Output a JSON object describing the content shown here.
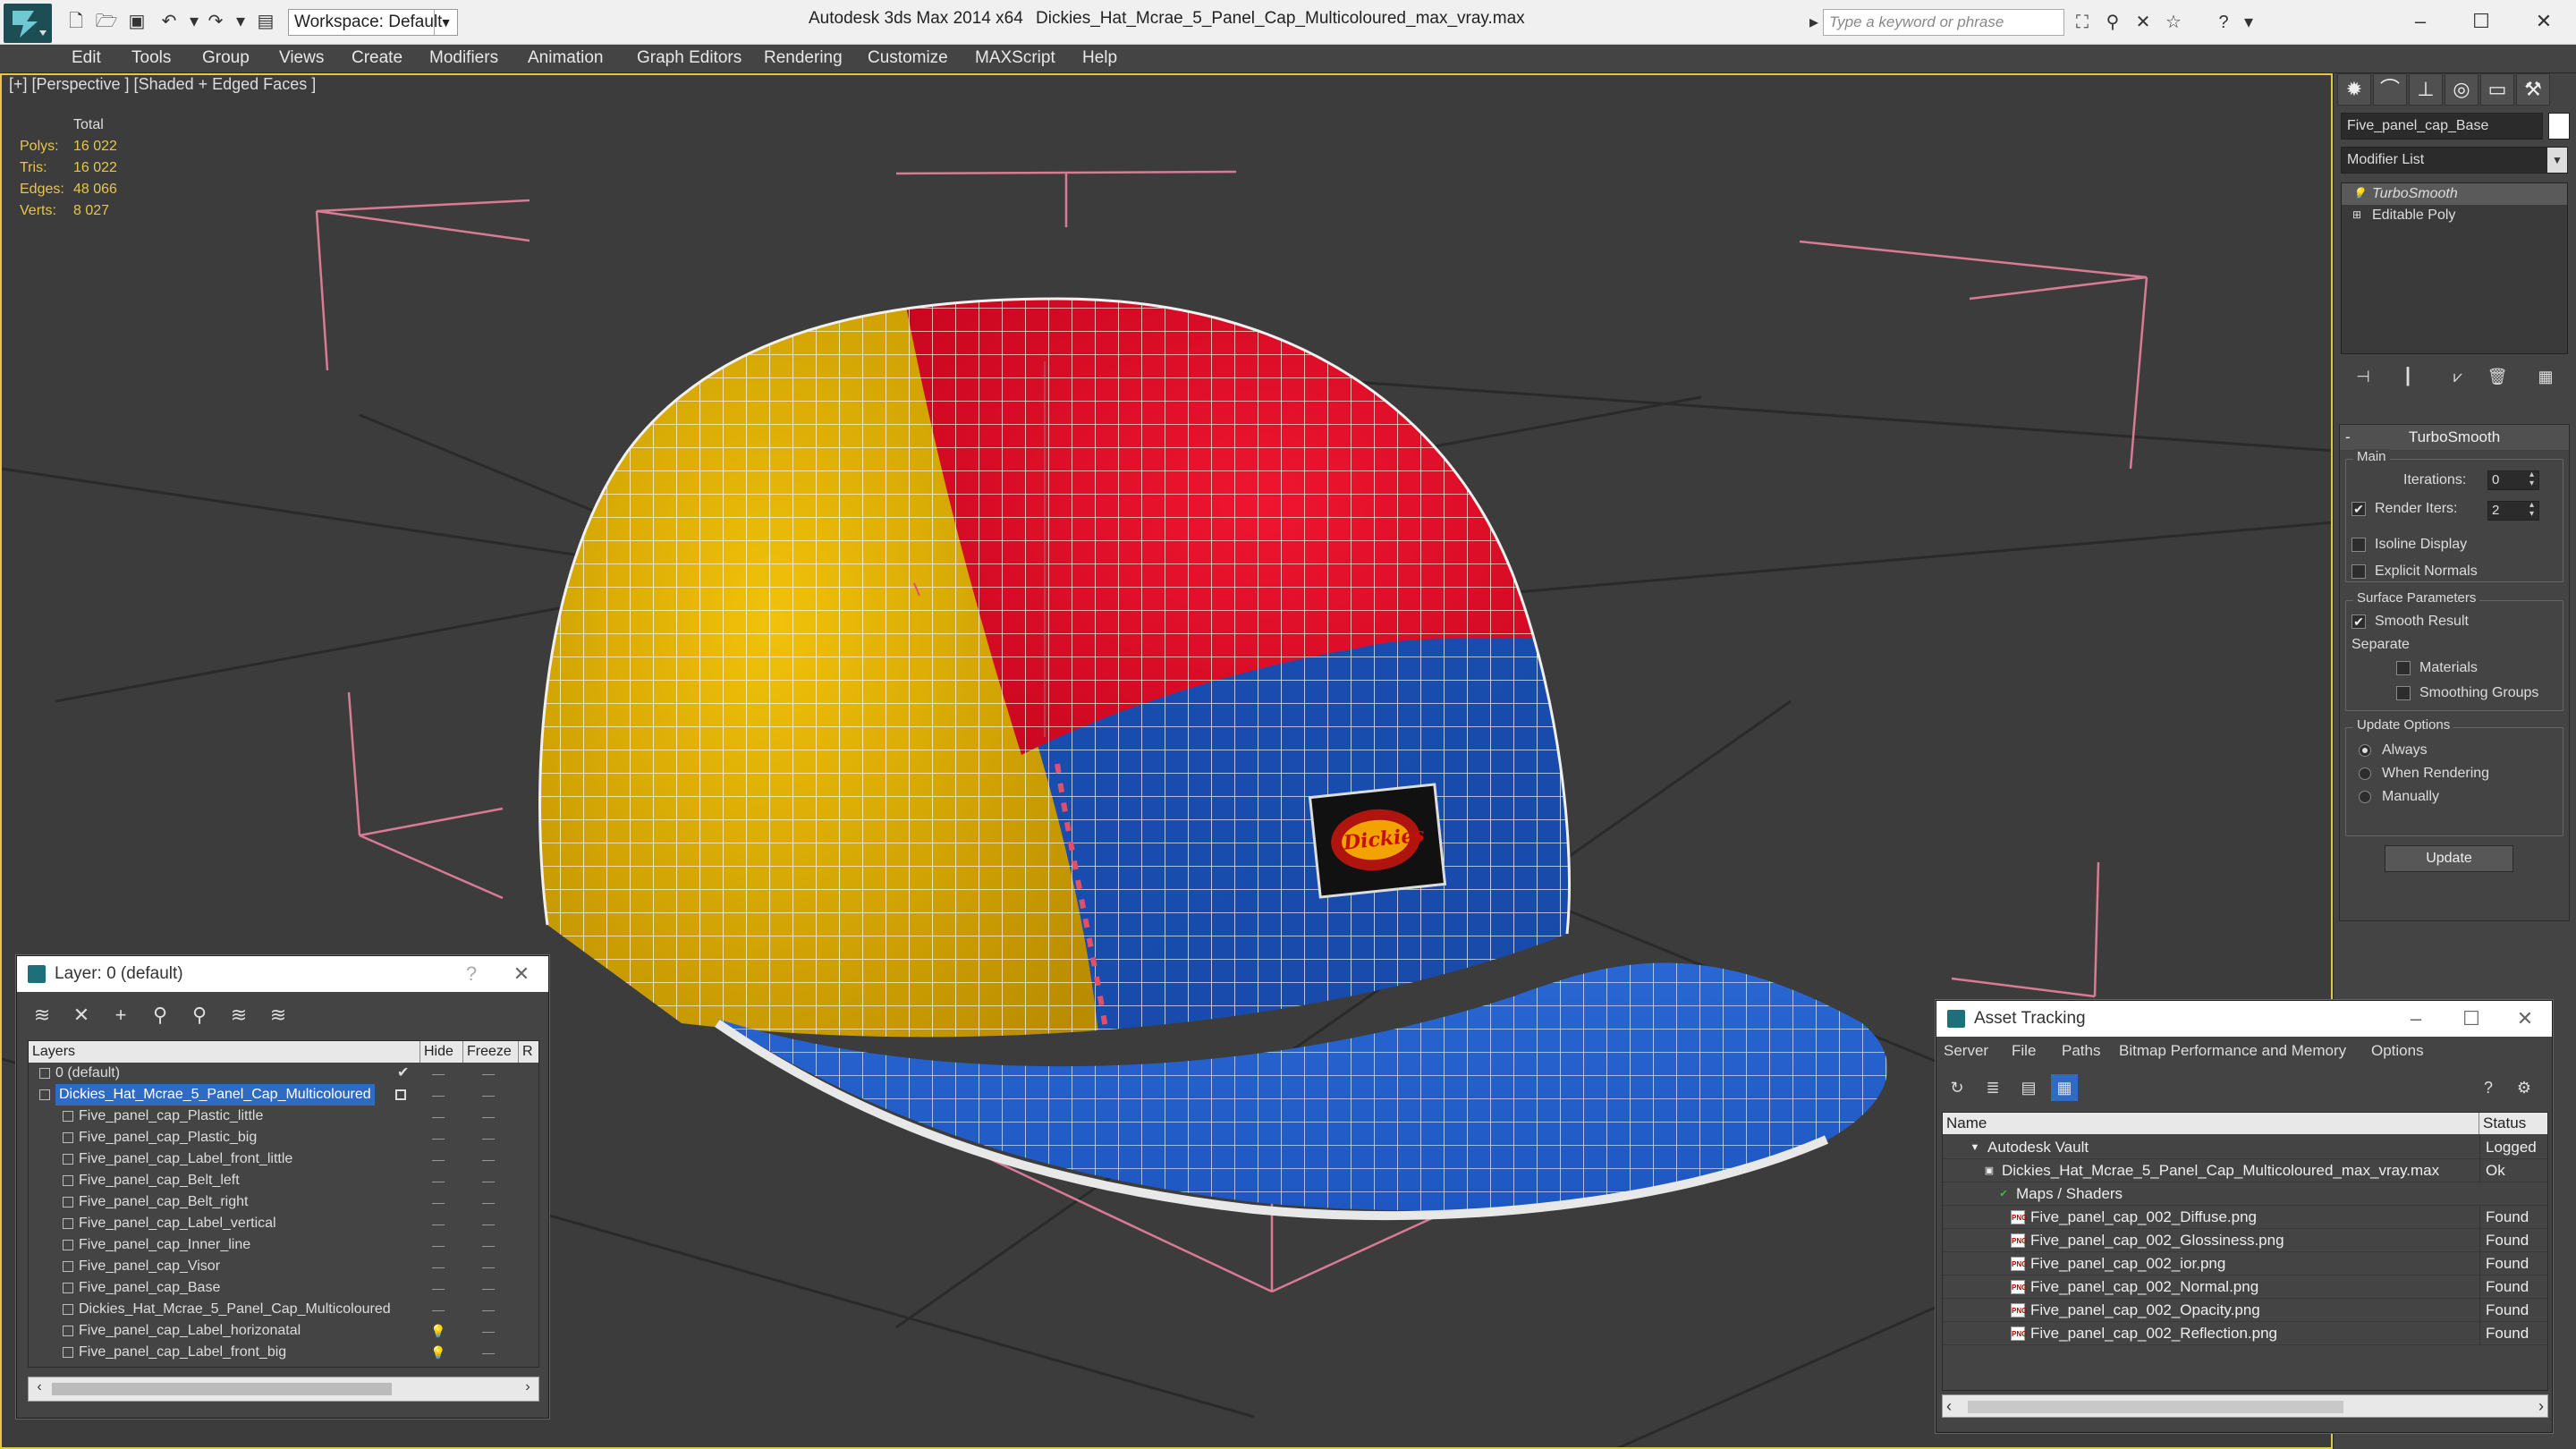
{
  "titlebar": {
    "workspace_label": "Workspace: Default",
    "app_title": "Autodesk 3ds Max  2014 x64",
    "file_name": "Dickies_Hat_Mcrae_5_Panel_Cap_Multicoloured_max_vray.max",
    "search_placeholder": "Type a keyword or phrase"
  },
  "menubar": [
    "Edit",
    "Tools",
    "Group",
    "Views",
    "Create",
    "Modifiers",
    "Animation",
    "Graph Editors",
    "Rendering",
    "Customize",
    "MAXScript",
    "Help"
  ],
  "viewport": {
    "label": "[+] [Perspective ] [Shaded + Edged Faces ]",
    "stats_header": "Total",
    "stats": [
      {
        "label": "Polys:",
        "value": "16 022"
      },
      {
        "label": "Tris:",
        "value": "16 022"
      },
      {
        "label": "Edges:",
        "value": "48 066"
      },
      {
        "label": "Verts:",
        "value": "8 027"
      }
    ],
    "logo_text": "Dickies"
  },
  "command_panel": {
    "object_name": "Five_panel_cap_Base",
    "modifier_list": "Modifier List",
    "stack": [
      "TurboSmooth",
      "Editable Poly"
    ],
    "rollout_title": "TurboSmooth",
    "main_group": "Main",
    "iterations_label": "Iterations:",
    "iterations_value": "0",
    "render_iters_label": "Render Iters:",
    "render_iters_value": "2",
    "isoline_label": "Isoline Display",
    "explicit_normals_label": "Explicit Normals",
    "surface_group": "Surface Parameters",
    "smooth_result_label": "Smooth Result",
    "separate_label": "Separate",
    "materials_label": "Materials",
    "smoothing_groups_label": "Smoothing Groups",
    "update_group": "Update Options",
    "always_label": "Always",
    "when_rendering_label": "When Rendering",
    "manually_label": "Manually",
    "update_button": "Update"
  },
  "layer_window": {
    "title": "Layer: 0 (default)",
    "help": "?",
    "col_layers": "Layers",
    "col_hide": "Hide",
    "col_freeze": "Freeze",
    "col_r": "R",
    "rows": [
      {
        "name": "0 (default)",
        "level": 1,
        "check": "✔"
      },
      {
        "name": "Dickies_Hat_Mcrae_5_Panel_Cap_Multicoloured",
        "level": 1,
        "selected": true
      },
      {
        "name": "Five_panel_cap_Plastic_little",
        "level": 2
      },
      {
        "name": "Five_panel_cap_Plastic_big",
        "level": 2
      },
      {
        "name": "Five_panel_cap_Label_front_little",
        "level": 2
      },
      {
        "name": "Five_panel_cap_Belt_left",
        "level": 2
      },
      {
        "name": "Five_panel_cap_Belt_right",
        "level": 2
      },
      {
        "name": "Five_panel_cap_Label_vertical",
        "level": 2
      },
      {
        "name": "Five_panel_cap_Inner_line",
        "level": 2
      },
      {
        "name": "Five_panel_cap_Visor",
        "level": 2
      },
      {
        "name": "Five_panel_cap_Base",
        "level": 2
      },
      {
        "name": "Dickies_Hat_Mcrae_5_Panel_Cap_Multicoloured",
        "level": 2
      },
      {
        "name": "Five_panel_cap_Label_horizonatal",
        "level": 2,
        "bulb": true
      },
      {
        "name": "Five_panel_cap_Label_front_big",
        "level": 2,
        "bulb": true
      }
    ]
  },
  "asset_window": {
    "title": "Asset Tracking",
    "menu": [
      "Server",
      "File",
      "Paths",
      "Bitmap Performance and Memory",
      "Options"
    ],
    "col_name": "Name",
    "col_status": "Status",
    "rows": [
      {
        "name": "Autodesk Vault",
        "status": "Logged",
        "indent": 1,
        "icon": "vault"
      },
      {
        "name": "Dickies_Hat_Mcrae_5_Panel_Cap_Multicoloured_max_vray.max",
        "status": "Ok",
        "indent": 2,
        "icon": "max"
      },
      {
        "name": "Maps / Shaders",
        "status": "",
        "indent": 3,
        "icon": "maps"
      },
      {
        "name": "Five_panel_cap_002_Diffuse.png",
        "status": "Found",
        "indent": 4,
        "icon": "png"
      },
      {
        "name": "Five_panel_cap_002_Glossiness.png",
        "status": "Found",
        "indent": 4,
        "icon": "png"
      },
      {
        "name": "Five_panel_cap_002_ior.png",
        "status": "Found",
        "indent": 4,
        "icon": "png"
      },
      {
        "name": "Five_panel_cap_002_Normal.png",
        "status": "Found",
        "indent": 4,
        "icon": "png"
      },
      {
        "name": "Five_panel_cap_002_Opacity.png",
        "status": "Found",
        "indent": 4,
        "icon": "png"
      },
      {
        "name": "Five_panel_cap_002_Reflection.png",
        "status": "Found",
        "indent": 4,
        "icon": "png"
      }
    ]
  },
  "colors": {
    "accent_yellow": "#e6c54a",
    "selection_blue": "#2f6ac3",
    "cap_red": "#e0102a",
    "cap_yellow": "#e2b404",
    "cap_blue": "#1e58c4"
  }
}
